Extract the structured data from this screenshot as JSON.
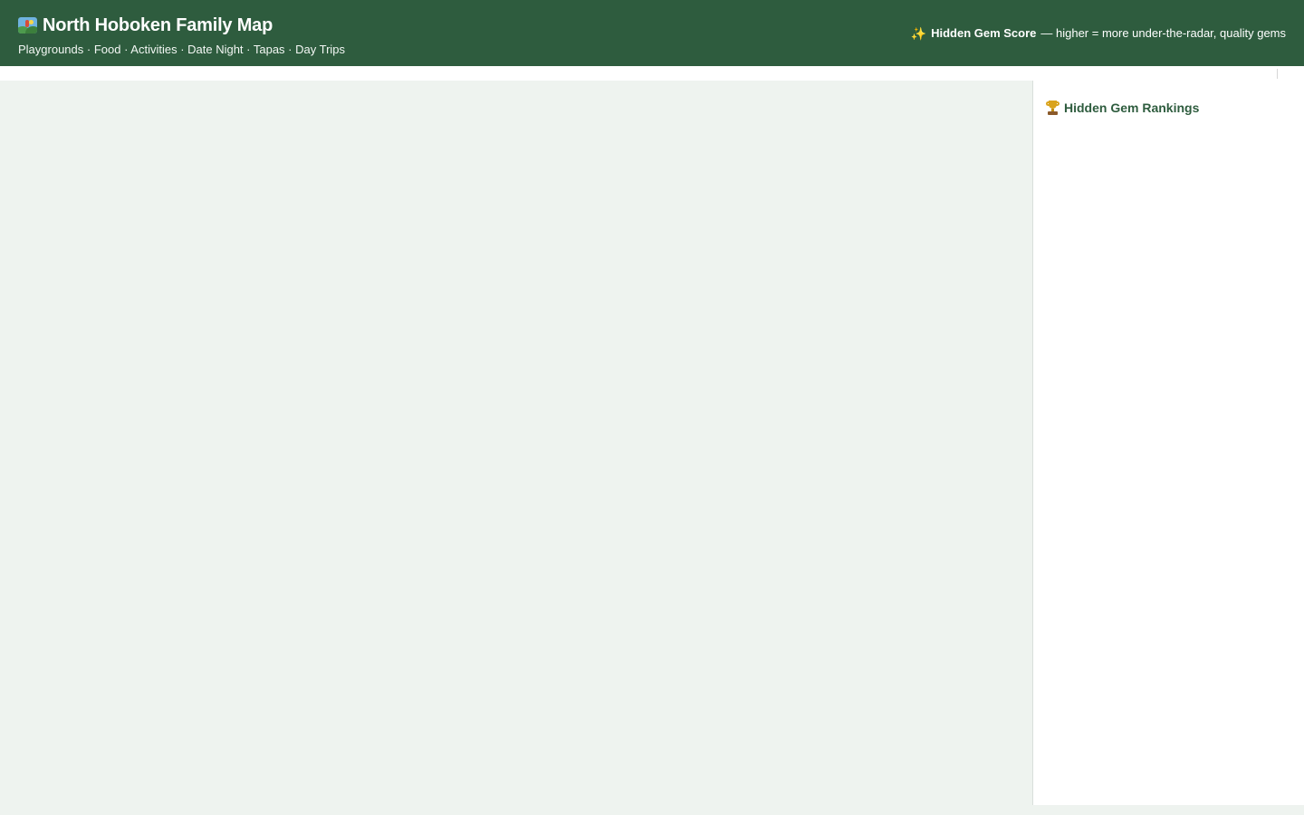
{
  "header": {
    "title": "North Hoboken Family Map",
    "title_icon": "world-map-icon",
    "subtitle": "Playgrounds · Food · Activities · Date Night · Tapas · Day Trips",
    "score_icon": "sparkles-icon",
    "score_label": "Hidden Gem Score",
    "score_description": "— higher = more under-the-radar, quality gems"
  },
  "sidebar": {
    "heading_icon": "trophy-icon",
    "heading": "Hidden Gem Rankings"
  },
  "colors": {
    "header_background": "#2e5c3e",
    "map_background": "#eef3ef",
    "accent_text": "#2e5c3e",
    "sidebar_background": "#ffffff"
  }
}
